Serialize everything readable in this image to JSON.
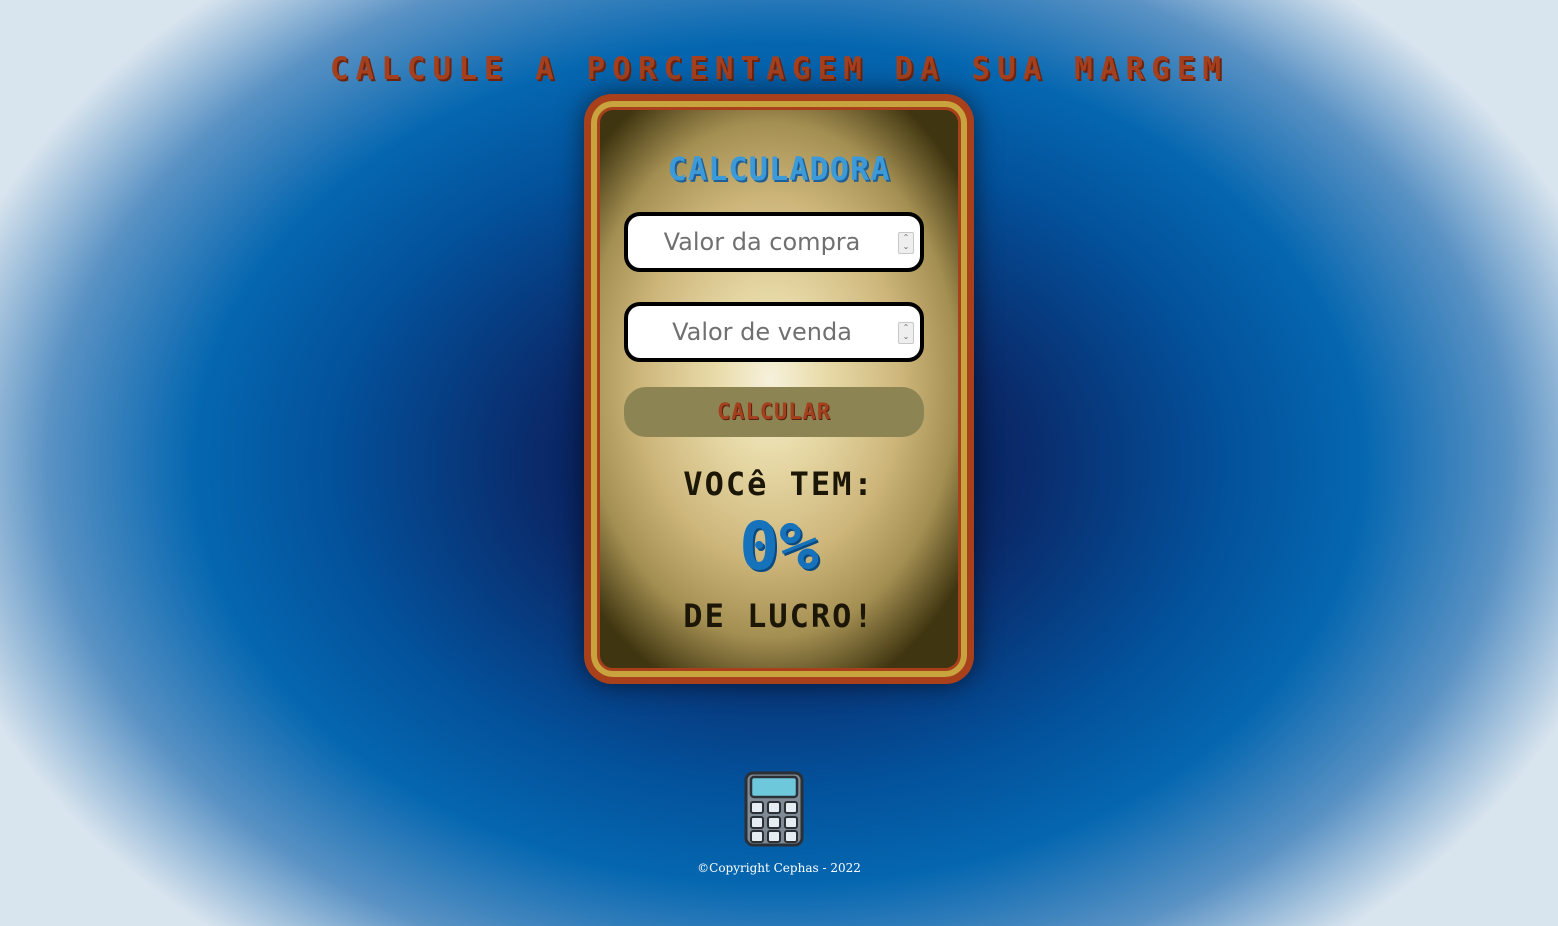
{
  "page": {
    "title": "Calcule a porcentagem da sua margem"
  },
  "calculator": {
    "heading": "CALCULADORA",
    "purchase_input": {
      "placeholder": "Valor da compra",
      "value": ""
    },
    "sale_input": {
      "placeholder": "Valor de venda",
      "value": ""
    },
    "calculate_button": "CALCULAR",
    "result_prefix": "VOCê TEM:",
    "result_value": "0%",
    "result_suffix": "DE LUCRO!"
  },
  "footer": {
    "icon": "calculator-icon",
    "copyright": "©Copyright Cephas - 2022"
  },
  "colors": {
    "title": "#a4401e",
    "heading": "#3d9ad8",
    "result_value": "#1572bb",
    "card_border": "#a8401c",
    "card_gold": "#c9a43e"
  }
}
